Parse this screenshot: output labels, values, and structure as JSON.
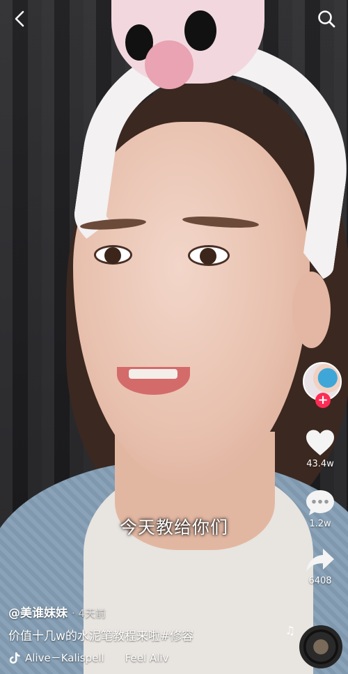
{
  "video": {
    "subtitle": "今天教给你们"
  },
  "top_bar": {
    "back_icon": "chevron-left-icon",
    "search_icon": "search-icon"
  },
  "side_rail": {
    "follow_symbol": "+",
    "like_count": "43.4w",
    "comment_count": "1.2w",
    "share_count": "6408",
    "accent_color": "#fe2c55"
  },
  "caption": {
    "author": "@美谁妹妹",
    "time": "· 4天前",
    "description": "价值十几w的水泥笔教程来啦#修容"
  },
  "music": {
    "track": "Alive－Kalispell",
    "track_repeat": "Feel Aliv"
  }
}
